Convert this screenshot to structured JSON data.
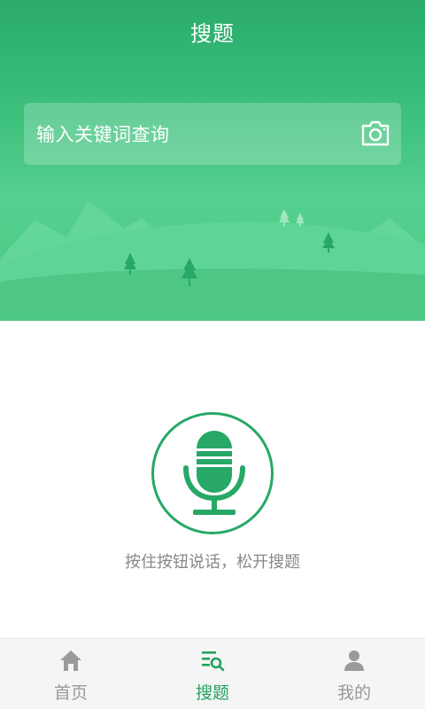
{
  "header": {
    "title": "搜题"
  },
  "search": {
    "placeholder": "输入关键词查询",
    "camera_icon": "camera-icon"
  },
  "voice": {
    "hint": "按住按钮说话，松开搜题",
    "mic_icon": "microphone-icon"
  },
  "tabbar": {
    "items": [
      {
        "label": "首页",
        "icon": "home-icon",
        "active": false
      },
      {
        "label": "搜题",
        "icon": "search-list-icon",
        "active": true
      },
      {
        "label": "我的",
        "icon": "user-icon",
        "active": false
      }
    ]
  },
  "colors": {
    "accent": "#23a262",
    "header_green": "#2aab6a",
    "inactive_tab": "#999999",
    "hint_text": "#888888"
  }
}
